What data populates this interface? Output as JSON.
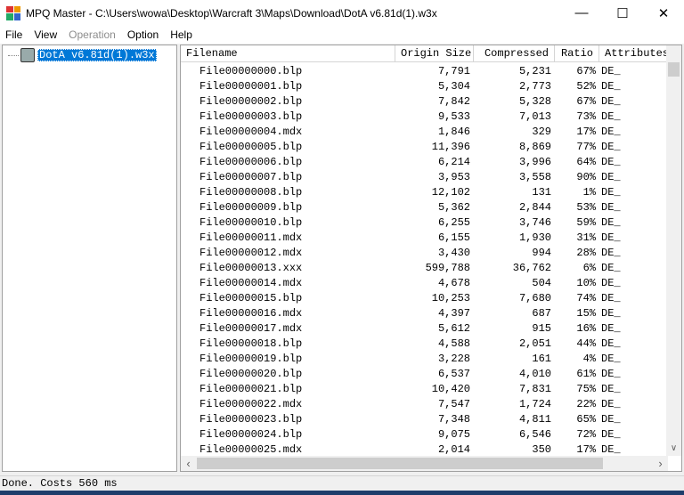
{
  "window": {
    "title": "MPQ Master - C:\\Users\\wowa\\Desktop\\Warcraft 3\\Maps\\Download\\DotA v6.81d(1).w3x",
    "minimize": "—",
    "maximize": "☐",
    "close": "✕"
  },
  "menu": [
    "File",
    "View",
    "Operation",
    "Option",
    "Help"
  ],
  "tree": {
    "root": "DotA v6.81d(1).w3x"
  },
  "list": {
    "columns": [
      "Filename",
      "Origin Size",
      "Compressed",
      "Ratio",
      "Attributes"
    ],
    "rows": [
      [
        "File00000000.blp",
        "7,791",
        "5,231",
        "67%",
        "DE_"
      ],
      [
        "File00000001.blp",
        "5,304",
        "2,773",
        "52%",
        "DE_"
      ],
      [
        "File00000002.blp",
        "7,842",
        "5,328",
        "67%",
        "DE_"
      ],
      [
        "File00000003.blp",
        "9,533",
        "7,013",
        "73%",
        "DE_"
      ],
      [
        "File00000004.mdx",
        "1,846",
        "329",
        "17%",
        "DE_"
      ],
      [
        "File00000005.blp",
        "11,396",
        "8,869",
        "77%",
        "DE_"
      ],
      [
        "File00000006.blp",
        "6,214",
        "3,996",
        "64%",
        "DE_"
      ],
      [
        "File00000007.blp",
        "3,953",
        "3,558",
        "90%",
        "DE_"
      ],
      [
        "File00000008.blp",
        "12,102",
        "131",
        "1%",
        "DE_"
      ],
      [
        "File00000009.blp",
        "5,362",
        "2,844",
        "53%",
        "DE_"
      ],
      [
        "File00000010.blp",
        "6,255",
        "3,746",
        "59%",
        "DE_"
      ],
      [
        "File00000011.mdx",
        "6,155",
        "1,930",
        "31%",
        "DE_"
      ],
      [
        "File00000012.mdx",
        "3,430",
        "994",
        "28%",
        "DE_"
      ],
      [
        "File00000013.xxx",
        "599,788",
        "36,762",
        "6%",
        "DE_"
      ],
      [
        "File00000014.mdx",
        "4,678",
        "504",
        "10%",
        "DE_"
      ],
      [
        "File00000015.blp",
        "10,253",
        "7,680",
        "74%",
        "DE_"
      ],
      [
        "File00000016.mdx",
        "4,397",
        "687",
        "15%",
        "DE_"
      ],
      [
        "File00000017.mdx",
        "5,612",
        "915",
        "16%",
        "DE_"
      ],
      [
        "File00000018.blp",
        "4,588",
        "2,051",
        "44%",
        "DE_"
      ],
      [
        "File00000019.blp",
        "3,228",
        "161",
        "4%",
        "DE_"
      ],
      [
        "File00000020.blp",
        "6,537",
        "4,010",
        "61%",
        "DE_"
      ],
      [
        "File00000021.blp",
        "10,420",
        "7,831",
        "75%",
        "DE_"
      ],
      [
        "File00000022.mdx",
        "7,547",
        "1,724",
        "22%",
        "DE_"
      ],
      [
        "File00000023.blp",
        "7,348",
        "4,811",
        "65%",
        "DE_"
      ],
      [
        "File00000024.blp",
        "9,075",
        "6,546",
        "72%",
        "DE_"
      ],
      [
        "File00000025.mdx",
        "2,014",
        "350",
        "17%",
        "DE_"
      ]
    ]
  },
  "status": "Done. Costs 560 ms",
  "colors": {
    "selection": "#0078d7"
  }
}
